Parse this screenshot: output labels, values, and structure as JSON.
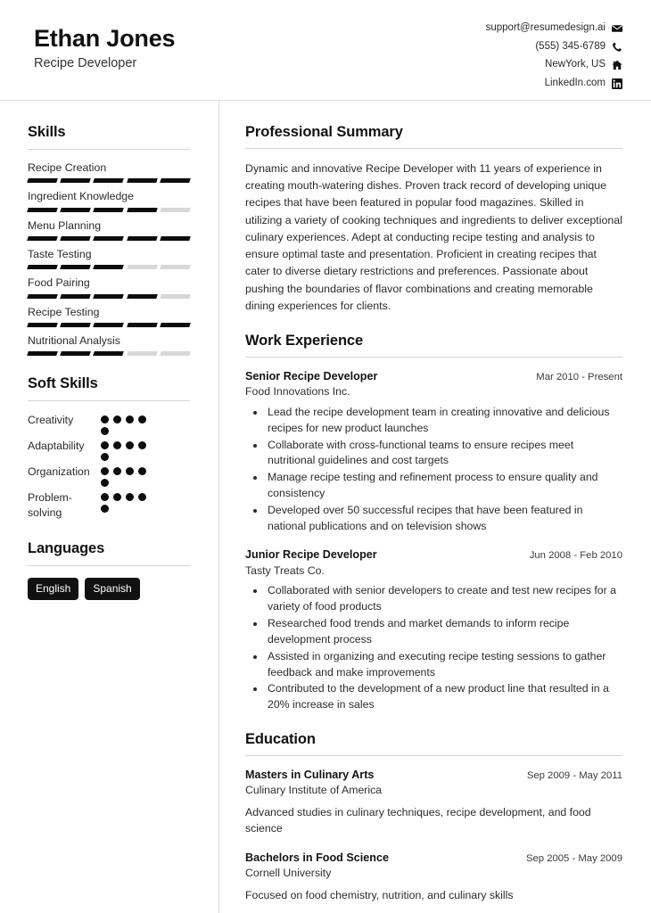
{
  "header": {
    "name": "Ethan Jones",
    "role": "Recipe Developer",
    "contacts": [
      {
        "text": "support@resumedesign.ai",
        "icon": "envelope-icon"
      },
      {
        "text": "(555) 345-6789",
        "icon": "phone-icon"
      },
      {
        "text": "NewYork, US",
        "icon": "home-icon"
      },
      {
        "text": "LinkedIn.com",
        "icon": "linkedin-icon"
      }
    ]
  },
  "sidebar": {
    "skills": {
      "title": "Skills",
      "max": 5,
      "items": [
        {
          "label": "Recipe Creation",
          "level": 5
        },
        {
          "label": "Ingredient Knowledge",
          "level": 4
        },
        {
          "label": "Menu Planning",
          "level": 5
        },
        {
          "label": "Taste Testing",
          "level": 3
        },
        {
          "label": "Food Pairing",
          "level": 4
        },
        {
          "label": "Recipe Testing",
          "level": 5
        },
        {
          "label": "Nutritional Analysis",
          "level": 3
        }
      ]
    },
    "soft_skills": {
      "title": "Soft Skills",
      "max": 5,
      "items": [
        {
          "label": "Creativity",
          "level": 5
        },
        {
          "label": "Adaptability",
          "level": 5
        },
        {
          "label": "Organization",
          "level": 5
        },
        {
          "label": "Problem-solving",
          "level": 5
        }
      ]
    },
    "languages": {
      "title": "Languages",
      "items": [
        "English",
        "Spanish"
      ]
    }
  },
  "main": {
    "summary": {
      "title": "Professional Summary",
      "text": "Dynamic and innovative Recipe Developer with 11 years of experience in creating mouth-watering dishes. Proven track record of developing unique recipes that have been featured in popular food magazines. Skilled in utilizing a variety of cooking techniques and ingredients to deliver exceptional culinary experiences. Adept at conducting recipe testing and analysis to ensure optimal taste and presentation. Proficient in creating recipes that cater to diverse dietary restrictions and preferences. Passionate about pushing the boundaries of flavor combinations and creating memorable dining experiences for clients."
    },
    "work": {
      "title": "Work Experience",
      "entries": [
        {
          "title": "Senior Recipe Developer",
          "date": "Mar 2010 - Present",
          "org": "Food Innovations Inc.",
          "bullets": [
            "Lead the recipe development team in creating innovative and delicious recipes for new product launches",
            "Collaborate with cross-functional teams to ensure recipes meet nutritional guidelines and cost targets",
            "Manage recipe testing and refinement process to ensure quality and consistency",
            "Developed over 50 successful recipes that have been featured in national publications and on television shows"
          ]
        },
        {
          "title": "Junior Recipe Developer",
          "date": "Jun 2008 - Feb 2010",
          "org": "Tasty Treats Co.",
          "bullets": [
            "Collaborated with senior developers to create and test new recipes for a variety of food products",
            "Researched food trends and market demands to inform recipe development process",
            "Assisted in organizing and executing recipe testing sessions to gather feedback and make improvements",
            "Contributed to the development of a new product line that resulted in a 20% increase in sales"
          ]
        }
      ]
    },
    "education": {
      "title": "Education",
      "entries": [
        {
          "title": "Masters in Culinary Arts",
          "date": "Sep 2009 - May 2011",
          "org": "Culinary Institute of America",
          "desc": "Advanced studies in culinary techniques, recipe development, and food science"
        },
        {
          "title": "Bachelors in Food Science",
          "date": "Sep 2005 - May 2009",
          "org": "Cornell University",
          "desc": "Focused on food chemistry, nutrition, and culinary skills"
        }
      ]
    }
  },
  "theme": {
    "accent": "#0d0d0d",
    "muted_bar": "#d7d7d7",
    "rule": "#d5d5d5"
  }
}
